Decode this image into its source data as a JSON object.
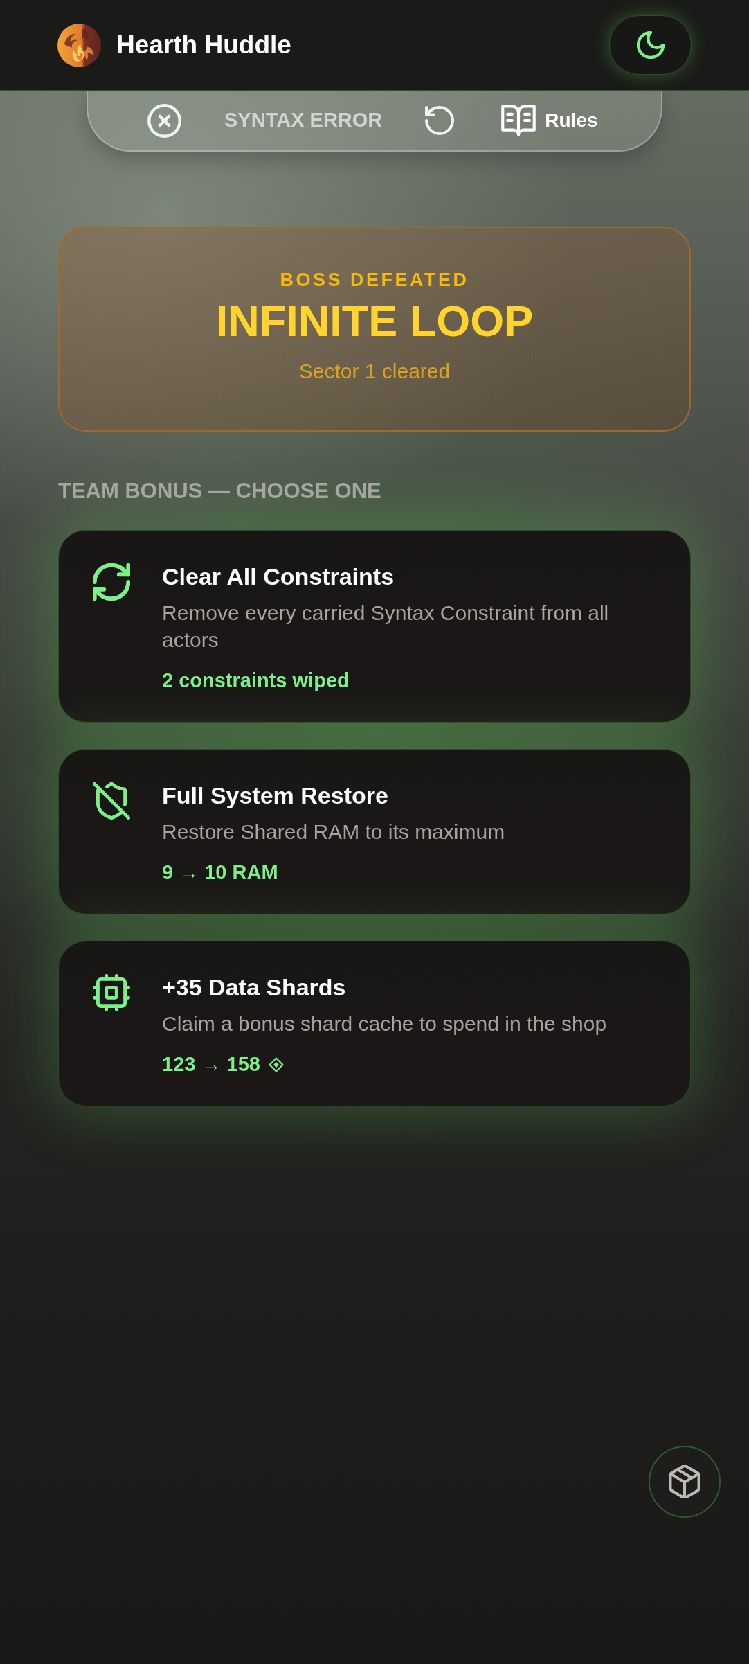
{
  "header": {
    "title": "Hearth Huddle"
  },
  "toolbar": {
    "status": "SYNTAX ERROR",
    "rules_button": "Rules"
  },
  "boss_banner": {
    "eyebrow": "BOSS DEFEATED",
    "title": "INFINITE LOOP",
    "subtitle": "Sector 1 cleared"
  },
  "bonus": {
    "heading": "TEAM BONUS — CHOOSE ONE",
    "options": [
      {
        "kind": "wipe",
        "title": "Clear All Constraints",
        "description": "Remove every carried Syntax Constraint from all actors",
        "effect": "2 constraints wiped",
        "selected": false
      },
      {
        "kind": "restore",
        "title": "Full System Restore",
        "description": "Restore Shared RAM to its maximum",
        "effect": "9 → 10 RAM",
        "selected": false
      },
      {
        "kind": "shards",
        "title": "+35 Data Shards",
        "description": "Claim a bonus shard cache to spend in the shop",
        "effect": "123 → 158",
        "selected": false
      }
    ]
  }
}
